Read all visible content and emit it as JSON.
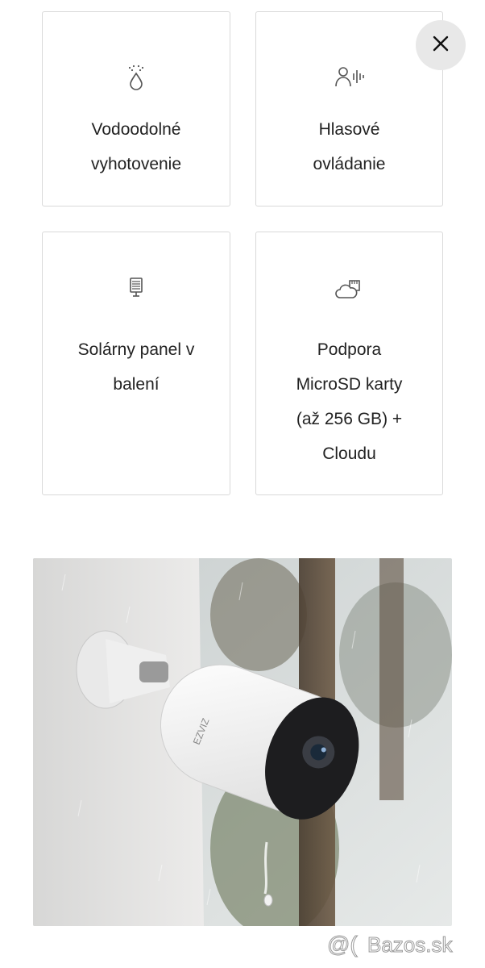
{
  "features": [
    {
      "icon": "water-drop-icon",
      "lines": [
        "Vodoodolné",
        "vyhotovenie"
      ]
    },
    {
      "icon": "voice-control-icon",
      "lines": [
        "Hlasové",
        "ovládanie"
      ]
    },
    {
      "icon": "solar-panel-icon",
      "lines": [
        "Solárny panel v",
        "balení"
      ]
    },
    {
      "icon": "sd-card-cloud-icon",
      "lines": [
        "Podpora",
        "MicroSD karty",
        "(až 256 GB) +",
        "Cloudu"
      ]
    }
  ],
  "close_button": {
    "icon": "close-icon"
  },
  "product_image": {
    "brand_logo_text": "EZVIZ"
  },
  "watermark": {
    "text": "Bazos.sk"
  }
}
